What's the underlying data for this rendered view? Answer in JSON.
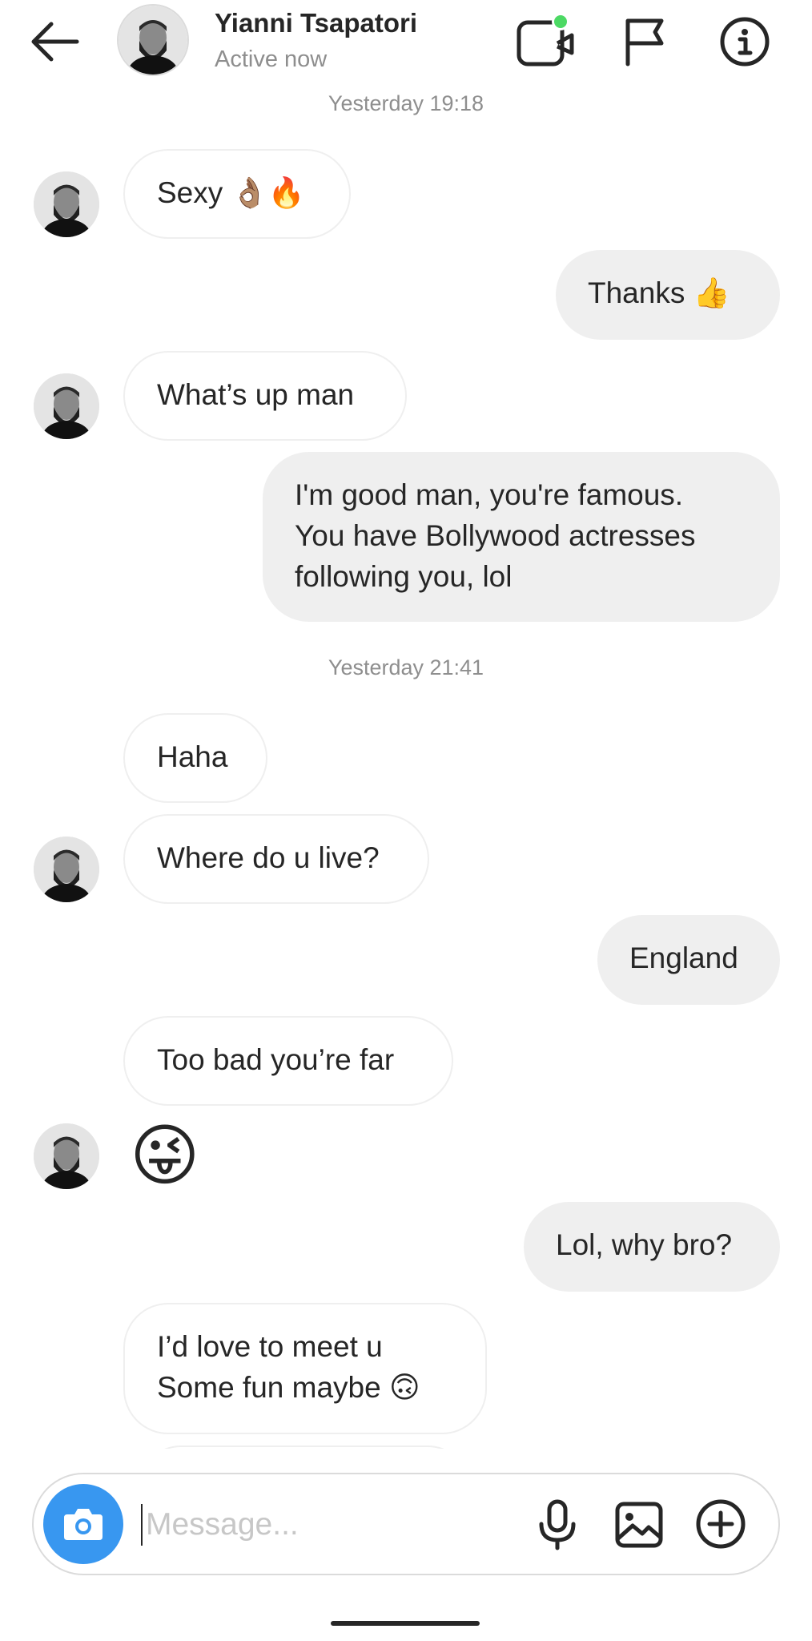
{
  "header": {
    "back_icon": "arrow-left-icon",
    "contact_name": "Yianni Tsapatori",
    "status": "Active now",
    "actions": [
      "video-call-icon",
      "flag-icon",
      "info-icon"
    ],
    "presence_color": "#4cd964"
  },
  "thread": {
    "timestamps": [
      "Yesterday 19:18",
      "Yesterday 21:41"
    ],
    "messages": [
      {
        "from": "contact",
        "text": "Sexy 👌🏽🔥"
      },
      {
        "from": "me",
        "text": "Thanks 👍"
      },
      {
        "from": "contact",
        "text": "What’s up man"
      },
      {
        "from": "me",
        "lines": [
          "I'm good man, you're famous.",
          "You have Bollywood actresses",
          "following you, lol"
        ]
      },
      {
        "from": "contact",
        "text": "Haha"
      },
      {
        "from": "contact",
        "text": "Where do u live?"
      },
      {
        "from": "me",
        "text": "England"
      },
      {
        "from": "contact",
        "text": "Too bad you’re far"
      },
      {
        "from": "contact",
        "text": "😜"
      },
      {
        "from": "me",
        "text": "Lol, why bro?"
      },
      {
        "from": "contact",
        "lines": [
          "I’d love to meet u",
          "Some fun maybe 🙃"
        ]
      }
    ]
  },
  "composer": {
    "placeholder": "Message...",
    "value": "",
    "camera_icon": "camera-icon",
    "mic_icon": "microphone-icon",
    "gallery_icon": "gallery-icon",
    "add_icon": "plus-circle-icon",
    "accent": "#3897f0"
  },
  "colors": {
    "incoming_bubble_border": "#efefef",
    "outgoing_bubble_bg": "#efefef",
    "timestamp": "#8e8e8e"
  }
}
